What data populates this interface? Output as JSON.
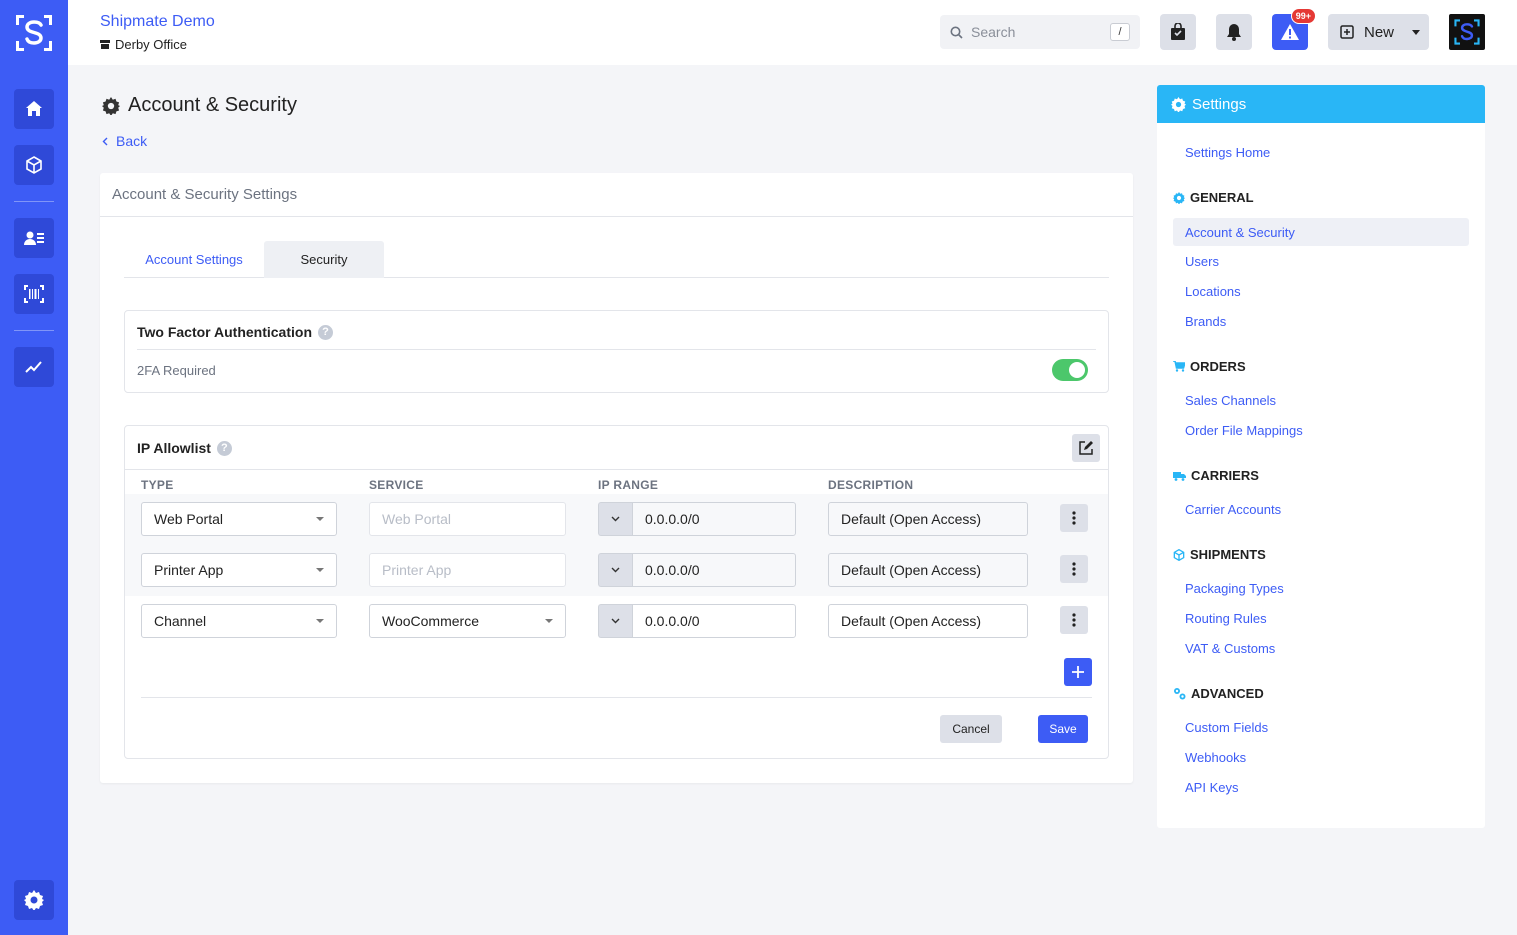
{
  "app": {
    "org_name": "Shipmate Demo",
    "location": "Derby Office",
    "search_placeholder": "Search",
    "search_shortcut": "/",
    "alert_badge": "99+",
    "new_label": "New",
    "accent": "#3d5cf5"
  },
  "rail": {
    "items": [
      "home-icon",
      "package-icon",
      "contacts-icon",
      "barcode-icon",
      "chart-icon"
    ],
    "bottom": "gear-icon"
  },
  "page": {
    "title": "Account & Security",
    "back_label": "Back",
    "card_title": "Account & Security Settings",
    "tabs": [
      {
        "label": "Account Settings",
        "active": false
      },
      {
        "label": "Security",
        "active": true
      }
    ]
  },
  "two_factor": {
    "title": "Two Factor Authentication",
    "help": "?",
    "label": "2FA Required",
    "enabled": true,
    "toggle_color": "#4cc76b"
  },
  "ip_allowlist": {
    "title": "IP Allowlist",
    "help": "?",
    "columns": [
      "TYPE",
      "SERVICE",
      "IP RANGE",
      "DESCRIPTION"
    ],
    "rows": [
      {
        "type": "Web Portal",
        "service": "Web Portal",
        "service_is_select": false,
        "ip": "0.0.0.0/0",
        "description": "Default (Open Access)"
      },
      {
        "type": "Printer App",
        "service": "Printer App",
        "service_is_select": false,
        "ip": "0.0.0.0/0",
        "description": "Default (Open Access)"
      },
      {
        "type": "Channel",
        "service": "WooCommerce",
        "service_is_select": true,
        "ip": "0.0.0.0/0",
        "description": "Default (Open Access)"
      }
    ],
    "cancel_label": "Cancel",
    "save_label": "Save"
  },
  "settings_panel": {
    "title": "Settings",
    "header_color": "#29b6f6",
    "home": "Settings Home",
    "sections": [
      {
        "name": "GENERAL",
        "icon": "gear-icon",
        "items": [
          "Account & Security",
          "Users",
          "Locations",
          "Brands"
        ]
      },
      {
        "name": "ORDERS",
        "icon": "cart-icon",
        "items": [
          "Sales Channels",
          "Order File Mappings"
        ]
      },
      {
        "name": "CARRIERS",
        "icon": "truck-icon",
        "items": [
          "Carrier Accounts"
        ]
      },
      {
        "name": "SHIPMENTS",
        "icon": "box-icon",
        "items": [
          "Packaging Types",
          "Routing Rules",
          "VAT & Customs"
        ]
      },
      {
        "name": "ADVANCED",
        "icon": "cogs-icon",
        "items": [
          "Custom Fields",
          "Webhooks",
          "API Keys"
        ]
      }
    ],
    "active_item": "Account & Security"
  }
}
